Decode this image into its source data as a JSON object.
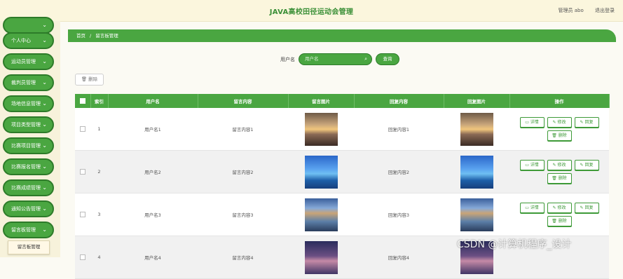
{
  "app": {
    "title": "JAVA高校田径运动会管理",
    "admin_label": "管理员 abo",
    "logout_label": "退出登录"
  },
  "sidebar": {
    "items": [
      {
        "label": "个人中心"
      },
      {
        "label": "运动员管理"
      },
      {
        "label": "裁判员管理"
      },
      {
        "label": "场地信息管理"
      },
      {
        "label": "项目类型管理"
      },
      {
        "label": "比赛项目管理"
      },
      {
        "label": "比赛报名管理"
      },
      {
        "label": "比赛成绩管理"
      },
      {
        "label": "通知公告管理"
      },
      {
        "label": "留言板管理"
      }
    ],
    "sub_item": "留言板管理"
  },
  "breadcrumb": {
    "home": "首页",
    "sep": "/",
    "current": "留言板管理"
  },
  "search": {
    "label": "用户名",
    "placeholder": "用户名",
    "button": "查询"
  },
  "toolbar": {
    "delete_label": "删除"
  },
  "table": {
    "headers": [
      "索引",
      "用户名",
      "留言内容",
      "留言图片",
      "回复内容",
      "回复图片",
      "操作"
    ],
    "actions": {
      "detail": "详情",
      "edit": "修改",
      "reply": "回复",
      "delete": "删除"
    },
    "rows": [
      {
        "index": "1",
        "username": "用户名1",
        "content": "留言内容1",
        "reply": "回复内容1",
        "img": "sunset-photo"
      },
      {
        "index": "2",
        "username": "用户名2",
        "content": "留言内容2",
        "reply": "回复内容2",
        "img": "mountain-lake-photo"
      },
      {
        "index": "3",
        "username": "用户名3",
        "content": "留言内容3",
        "reply": "回复内容3",
        "img": "lake-pier-photo"
      },
      {
        "index": "4",
        "username": "用户名4",
        "content": "留言内容4",
        "reply": "回复内容4",
        "img": "night-sky-photo"
      }
    ]
  },
  "watermark": "CSDN @计算机程序_设计",
  "colors": {
    "accent": "#4aa641",
    "accent_dark": "#2d7b29",
    "header_bg": "#fbf6dd"
  }
}
